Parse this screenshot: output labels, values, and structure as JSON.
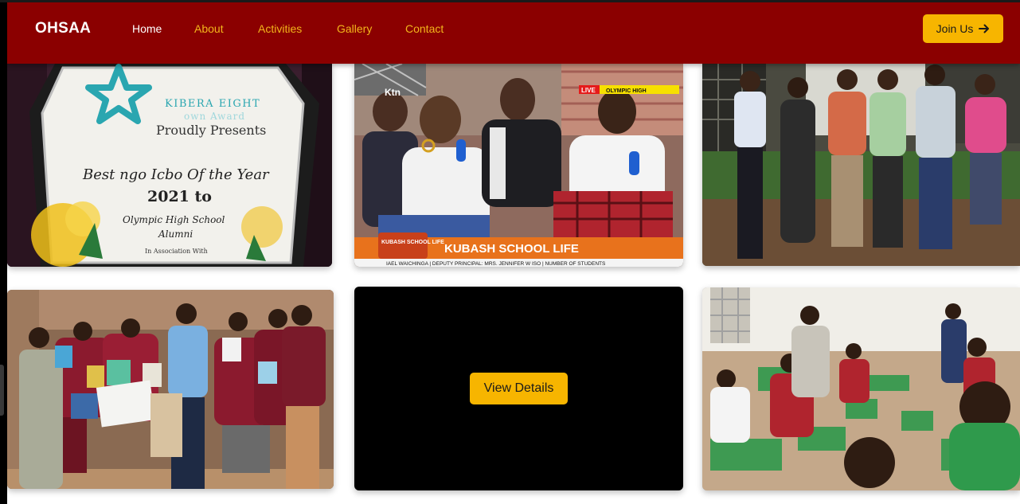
{
  "nav": {
    "brand": "OHSAA",
    "links": [
      {
        "label": "Home",
        "active": true
      },
      {
        "label": "About"
      },
      {
        "label": "Activities"
      },
      {
        "label": "Gallery"
      },
      {
        "label": "Contact"
      }
    ],
    "join_label": "Join Us",
    "join_icon": "arrow-right-icon"
  },
  "gallery": {
    "award": {
      "brand_line1": "KIBERA EIGHT",
      "brand_line2": "own Award",
      "presents": "Proudly Presents",
      "title": "Best ngo Icbo Of the Year",
      "year": "2021 to",
      "recipient_line1": "Olympic High School",
      "recipient_line2": "Alumni",
      "footer": "In Association With"
    },
    "tv": {
      "channel": "Ktn",
      "live": "LIVE",
      "school": "OLYMPIC HIGH",
      "show_logo": "KUBASH SCHOOL LIFE",
      "headline": "KUBASH SCHOOL LIFE",
      "ticker": "IAEL WAICHINGA | DEPUTY PRINCIPAL: MRS. JENNIFER W ISO | NUMBER OF STUDENTS"
    },
    "view_details_label": "View Details"
  },
  "colors": {
    "navbar": "#8b0000",
    "accent": "#f7b500",
    "nav_link": "#f3b51b",
    "school_uniform": "#8b1a2e"
  }
}
